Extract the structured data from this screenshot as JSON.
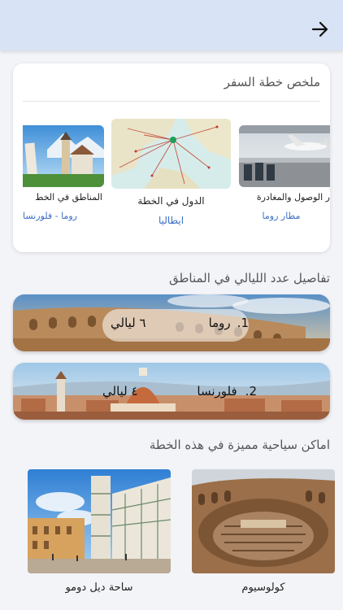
{
  "header": {
    "back_icon": "arrow-right-icon",
    "background": "#d9e3f6"
  },
  "summary": {
    "title": "ملخص خطة السفر",
    "items": [
      {
        "label": "ر الوصول والمغادرة",
        "value": "مطار روما",
        "image": "airport-photo"
      },
      {
        "label": "الدول في الخطة",
        "value": "ايطاليا",
        "image": "map-photo"
      },
      {
        "label": "المناطق في الخط",
        "value": "روما - فلورنسا",
        "image": "pisa-photo"
      }
    ]
  },
  "nights": {
    "title": "تفاصيل عدد الليالي في المناطق",
    "items": [
      {
        "index": "1.",
        "city": "روما",
        "nights": "٦ ليالي",
        "image": "colosseum-banner"
      },
      {
        "index": "2.",
        "city": "فلورنسا",
        "nights": "٤ ليالي",
        "image": "florence-banner"
      }
    ]
  },
  "places": {
    "title": "اماكن سياحية مميزة في هذه الخطة",
    "items": [
      {
        "label": "كولوسيوم",
        "image": "colosseum-photo"
      },
      {
        "label": "ساحة ديل دومو",
        "image": "duomo-square-photo"
      }
    ]
  },
  "colors": {
    "accent": "#3b6fc4",
    "background": "#f3f4f8"
  }
}
